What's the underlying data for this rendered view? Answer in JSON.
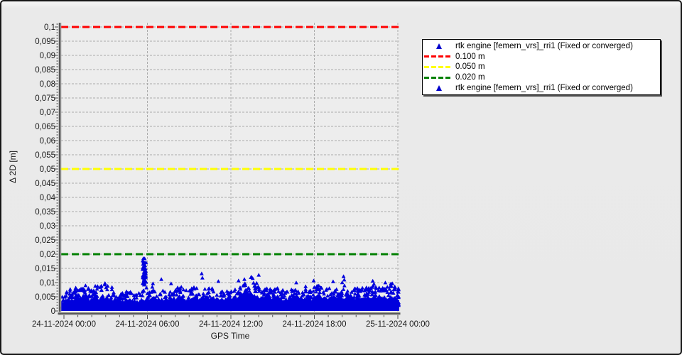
{
  "chart_data": {
    "type": "scatter",
    "title": "",
    "xlabel": "GPS Time",
    "ylabel": "Δ 2D [m]",
    "ylim": [
      0,
      0.1015
    ],
    "xlim_hours": [
      0,
      24.3
    ],
    "grid": true,
    "plot_bg": "#ededed",
    "series": [
      {
        "name": "rtk engine [femern_vrs]_rri1 (Fixed or converged)",
        "marker": "triangle",
        "color": "#0000dd"
      }
    ],
    "ref_lines": [
      {
        "value": 0.1,
        "label": "0.100 m",
        "color": "#fe0000"
      },
      {
        "value": 0.05,
        "label": "0.050 m",
        "color": "#ffff00"
      },
      {
        "value": 0.02,
        "label": "0.020 m",
        "color": "#008000"
      }
    ],
    "legend": {
      "entries": [
        {
          "type": "marker",
          "color": "#0000cc",
          "label": "rtk engine [femern_vrs]_rri1 (Fixed or converged)"
        },
        {
          "type": "line",
          "color": "#fe0000",
          "label": "0.100 m"
        },
        {
          "type": "line",
          "color": "#ffff00",
          "label": "0.050 m"
        },
        {
          "type": "line",
          "color": "#008000",
          "label": "0.020 m"
        },
        {
          "type": "marker",
          "color": "#0000cc",
          "label": "rtk engine [femern_vrs]_rri1 (Fixed or converged)"
        }
      ]
    },
    "x_ticks": [
      {
        "t": 0,
        "label": "24-11-2024 00:00"
      },
      {
        "t": 6,
        "label": "24-11-2024 06:00"
      },
      {
        "t": 12,
        "label": "24-11-2024 12:00"
      },
      {
        "t": 18,
        "label": "24-11-2024 18:00"
      },
      {
        "t": 24,
        "label": "25-11-2024 00:00"
      }
    ],
    "y_ticks": [
      {
        "v": 0.1,
        "label": "0,1"
      },
      {
        "v": 0.095,
        "label": "0,095"
      },
      {
        "v": 0.09,
        "label": "0,09"
      },
      {
        "v": 0.085,
        "label": "0,085"
      },
      {
        "v": 0.08,
        "label": "0,08"
      },
      {
        "v": 0.075,
        "label": "0,075"
      },
      {
        "v": 0.07,
        "label": "0,07"
      },
      {
        "v": 0.065,
        "label": "0,065"
      },
      {
        "v": 0.06,
        "label": "0,06"
      },
      {
        "v": 0.055,
        "label": "0,055"
      },
      {
        "v": 0.05,
        "label": "0,05"
      },
      {
        "v": 0.045,
        "label": "0,045"
      },
      {
        "v": 0.04,
        "label": "0,04"
      },
      {
        "v": 0.035,
        "label": "0,035"
      },
      {
        "v": 0.03,
        "label": "0,03"
      },
      {
        "v": 0.025,
        "label": "0,025"
      },
      {
        "v": 0.02,
        "label": "0,02"
      },
      {
        "v": 0.015,
        "label": "0,015"
      },
      {
        "v": 0.01,
        "label": "0,01"
      },
      {
        "v": 0.005,
        "label": "0,005"
      },
      {
        "v": 0,
        "label": "0"
      }
    ],
    "cloud_envelope": [
      [
        0,
        0.0055
      ],
      [
        0.3,
        0.007
      ],
      [
        0.7,
        0.0075
      ],
      [
        1.1,
        0.008
      ],
      [
        1.5,
        0.0085
      ],
      [
        1.9,
        0.007
      ],
      [
        2.3,
        0.0085
      ],
      [
        2.7,
        0.009
      ],
      [
        3.1,
        0.0095
      ],
      [
        3.5,
        0.0075
      ],
      [
        3.9,
        0.008
      ],
      [
        4.3,
        0.0065
      ],
      [
        4.7,
        0.007
      ],
      [
        5.1,
        0.006
      ],
      [
        5.5,
        0.0065
      ],
      [
        5.9,
        0.0075
      ],
      [
        6.3,
        0.0085
      ],
      [
        6.7,
        0.007
      ],
      [
        7.1,
        0.0075
      ],
      [
        7.5,
        0.0065
      ],
      [
        7.9,
        0.007
      ],
      [
        8.3,
        0.0085
      ],
      [
        8.7,
        0.0075
      ],
      [
        9.1,
        0.008
      ],
      [
        9.5,
        0.0085
      ],
      [
        9.9,
        0.0075
      ],
      [
        10.3,
        0.009
      ],
      [
        10.7,
        0.008
      ],
      [
        11.1,
        0.0065
      ],
      [
        11.5,
        0.007
      ],
      [
        11.9,
        0.0075
      ],
      [
        12.3,
        0.008
      ],
      [
        12.7,
        0.0095
      ],
      [
        13.1,
        0.0105
      ],
      [
        13.5,
        0.0115
      ],
      [
        13.9,
        0.009
      ],
      [
        14.3,
        0.0075
      ],
      [
        14.7,
        0.008
      ],
      [
        15.1,
        0.0085
      ],
      [
        15.5,
        0.0075
      ],
      [
        15.9,
        0.007
      ],
      [
        16.3,
        0.0075
      ],
      [
        16.7,
        0.008
      ],
      [
        17.1,
        0.0075
      ],
      [
        17.5,
        0.0085
      ],
      [
        17.9,
        0.008
      ],
      [
        18.3,
        0.009
      ],
      [
        18.7,
        0.0085
      ],
      [
        19.1,
        0.008
      ],
      [
        19.5,
        0.0085
      ],
      [
        19.9,
        0.0105
      ],
      [
        20.3,
        0.008
      ],
      [
        20.7,
        0.0075
      ],
      [
        21.1,
        0.008
      ],
      [
        21.5,
        0.0085
      ],
      [
        21.9,
        0.008
      ],
      [
        22.3,
        0.009
      ],
      [
        22.7,
        0.0085
      ],
      [
        23.1,
        0.008
      ],
      [
        23.5,
        0.009
      ],
      [
        23.8,
        0.0085
      ],
      [
        24,
        0.008
      ],
      [
        24.3,
        0.0075
      ]
    ],
    "outliers": [
      [
        0.45,
        0.0075
      ],
      [
        0.85,
        0.008
      ],
      [
        1.55,
        0.0088
      ],
      [
        2.25,
        0.0086
      ],
      [
        2.95,
        0.0096
      ],
      [
        3.45,
        0.0082
      ],
      [
        6.4,
        0.0095
      ],
      [
        7.0,
        0.011
      ],
      [
        7.7,
        0.0095
      ],
      [
        9.9,
        0.013
      ],
      [
        9.95,
        0.0115
      ],
      [
        11.1,
        0.0103
      ],
      [
        12.55,
        0.0105
      ],
      [
        12.97,
        0.011
      ],
      [
        13.48,
        0.0118
      ],
      [
        14.0,
        0.0125
      ],
      [
        16.7,
        0.0098
      ],
      [
        17.95,
        0.0105
      ],
      [
        19.35,
        0.0102
      ],
      [
        20.1,
        0.012
      ],
      [
        20.15,
        0.0108
      ],
      [
        22.2,
        0.0104
      ],
      [
        23.1,
        0.0098
      ],
      [
        23.6,
        0.0095
      ]
    ],
    "spike_cluster": {
      "t_start": 5.65,
      "t_end": 5.9,
      "v_min": 0.0085,
      "v_max": 0.0185,
      "count": 55
    }
  }
}
